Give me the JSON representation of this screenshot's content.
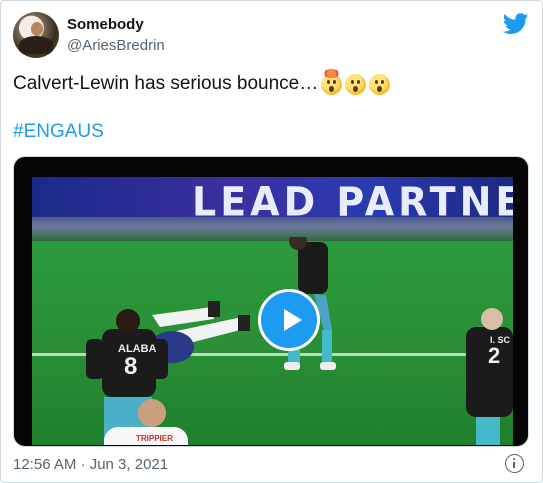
{
  "tweet": {
    "author_name": "Somebody",
    "author_handle": "@AriesBredrin",
    "text": "Calvert-Lewin has serious bounce…",
    "emojis": [
      "exploding-head-emoji",
      "astonished-face-emoji",
      "hushed-face-emoji"
    ],
    "hashtag": "#ENGAUS",
    "timestamp": "12:56 AM · Jun 3, 2021"
  },
  "media": {
    "type": "video",
    "billboard_text": "LEAD PARTNER",
    "player_name_left": "ALABA",
    "player_number_left": "8",
    "player_name_front": "TRIPPIER",
    "player_number_right": "2",
    "player_name_right": "I. SC",
    "play_icon": "play-icon"
  },
  "colors": {
    "accent": "#1d9bf0",
    "text_primary": "#0f1419",
    "text_secondary": "#536471",
    "border": "#cfd9de"
  }
}
